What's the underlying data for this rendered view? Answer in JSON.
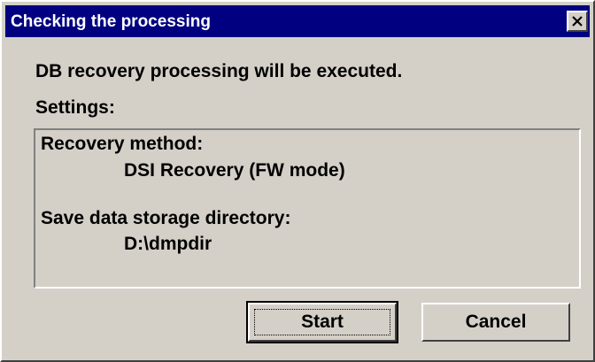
{
  "dialog": {
    "title": "Checking the processing",
    "close_icon": "close-icon",
    "message": "DB recovery processing will be executed.",
    "settings_label": "Settings:",
    "settings": {
      "recovery_method_label": "Recovery method:",
      "recovery_method_value": "DSI Recovery (FW mode)",
      "save_dir_label": "Save data storage directory:",
      "save_dir_value": "D:\\dmpdir"
    },
    "buttons": {
      "start": "Start",
      "cancel": "Cancel"
    }
  },
  "colors": {
    "titlebar": "#000080",
    "face": "#d4d0c8"
  }
}
